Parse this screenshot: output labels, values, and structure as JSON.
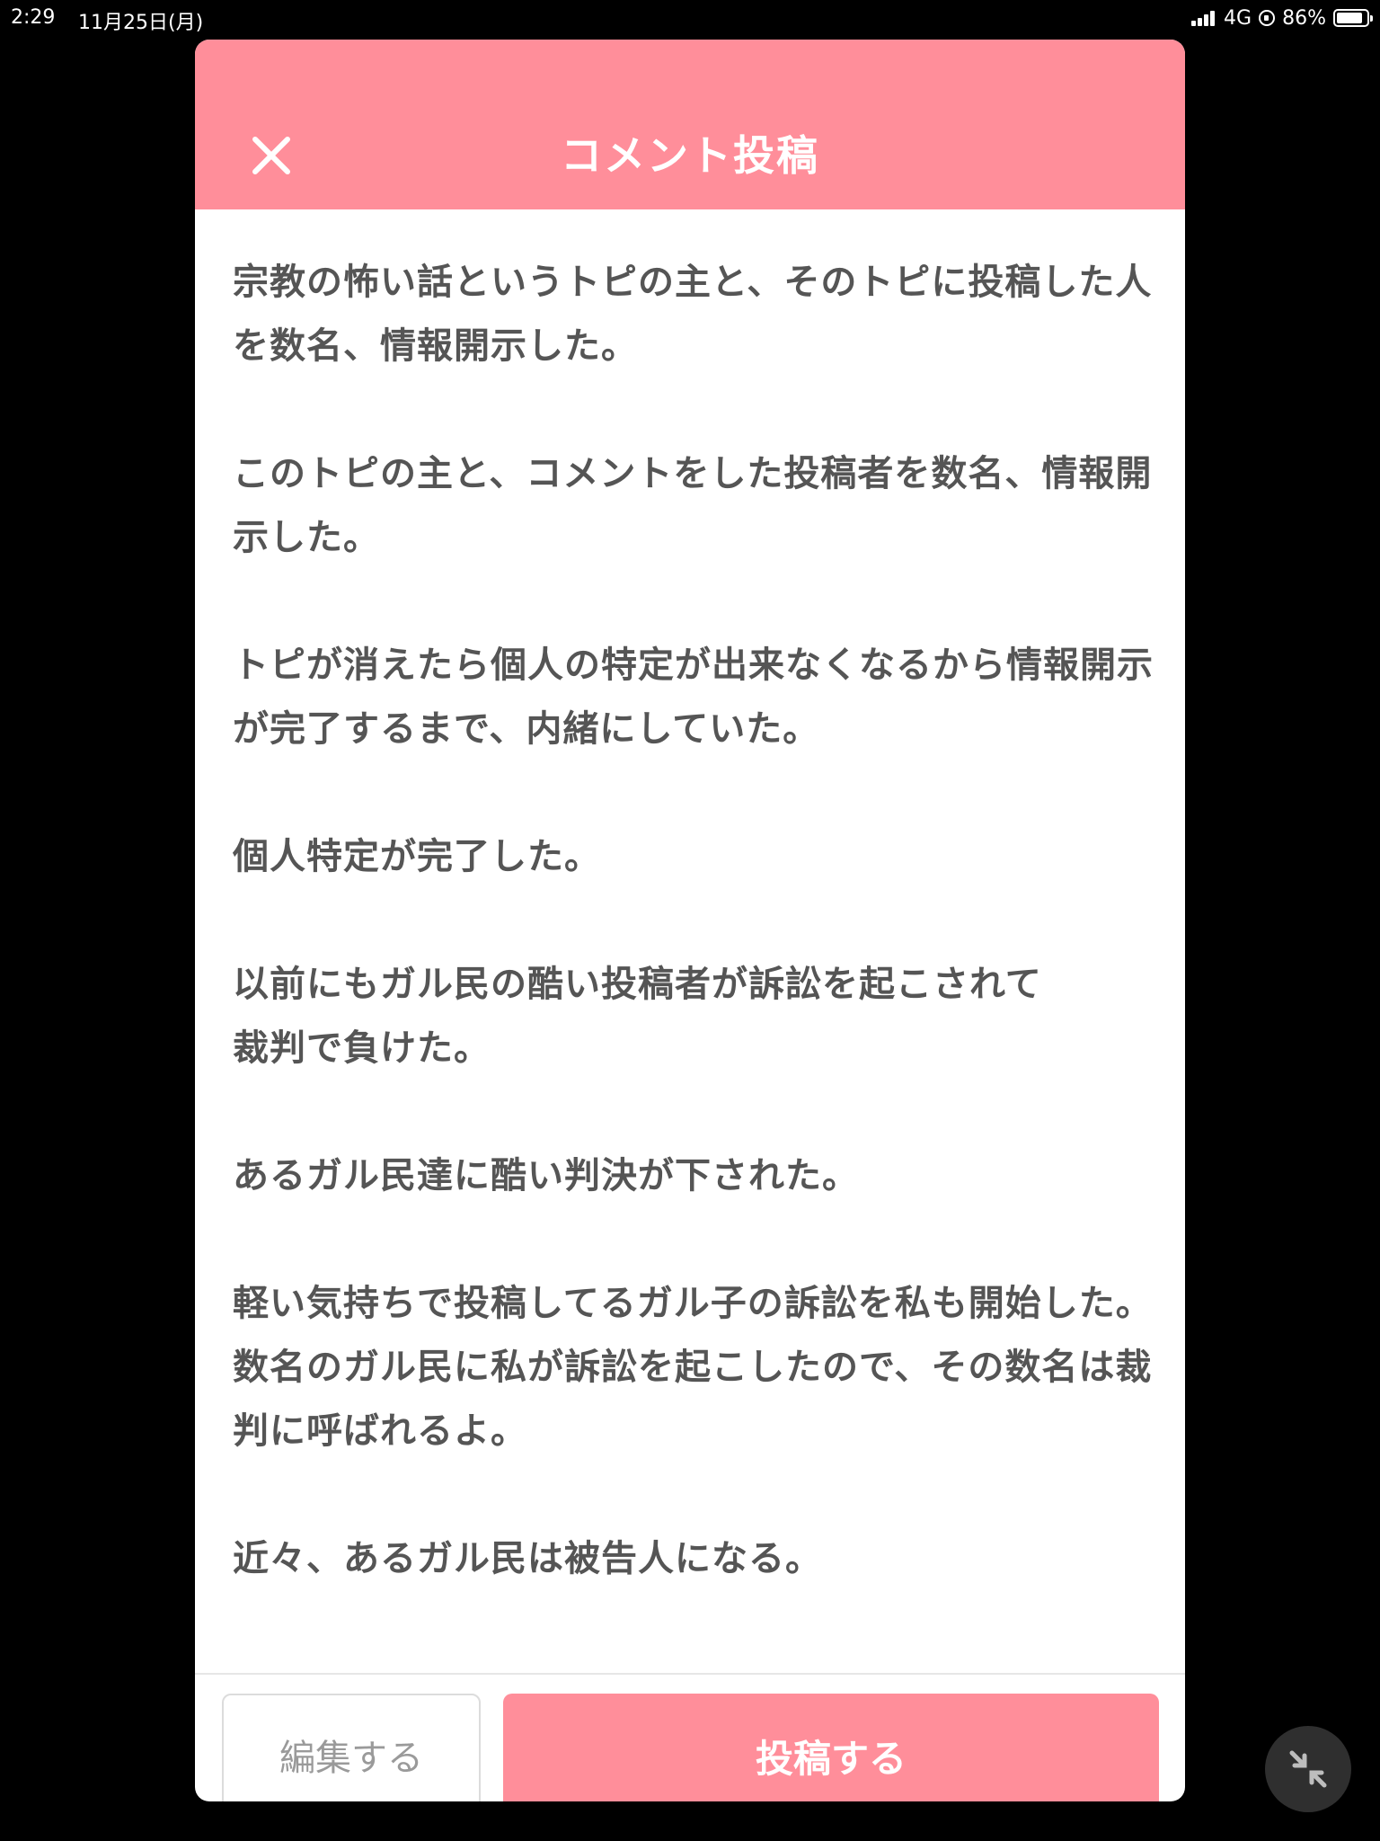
{
  "status_bar": {
    "time": "2:29",
    "date": "11月25日(月)",
    "network": "4G",
    "battery_percent": "86%",
    "battery_level": 0.86,
    "icons": [
      "signal-icon",
      "lock-rotation-icon",
      "battery-icon"
    ]
  },
  "modal": {
    "title": "コメント投稿",
    "close_icon": "close-icon",
    "comment_text": "宗教の怖い話というトピの主と、そのトピに投稿した人を数名、情報開示した。\n\nこのトピの主と、コメントをした投稿者を数名、情報開示した。\n\nトピが消えたら個人の特定が出来なくなるから情報開示が完了するまで、内緒にしていた。\n\n個人特定が完了した。\n\n以前にもガル民の酷い投稿者が訴訟を起こされて\n裁判で負けた。\n\nあるガル民達に酷い判決が下された。\n\n軽い気持ちで投稿してるガル子の訴訟を私も開始した。\n数名のガル民に私が訴訟を起こしたので、その数名は裁判に呼ばれるよ。\n\n近々、あるガル民は被告人になる。",
    "edit_button_label": "編集する",
    "post_button_label": "投稿する"
  },
  "floating_button": {
    "icon": "minimize-icon"
  },
  "colors": {
    "accent_pink": "#ff8e9a",
    "text_gray": "#555555",
    "background": "#000000"
  }
}
